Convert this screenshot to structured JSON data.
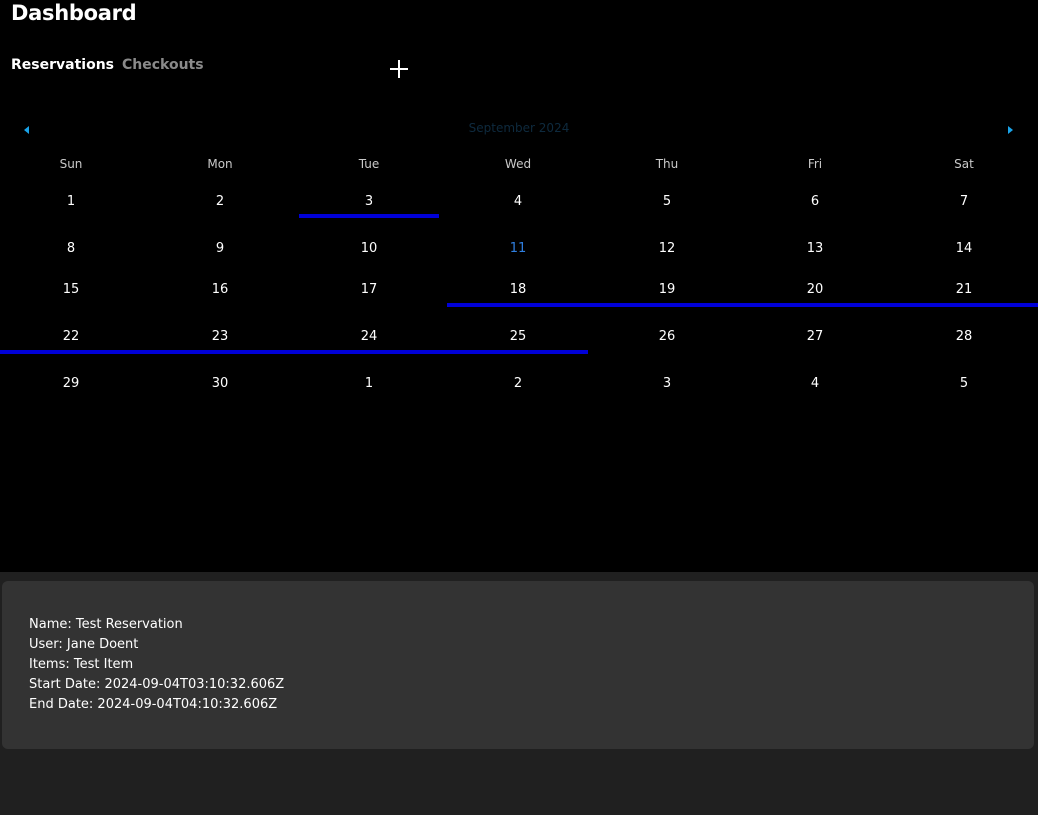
{
  "header": {
    "title": "Dashboard"
  },
  "tabs": [
    {
      "label": "Reservations",
      "active": true
    },
    {
      "label": "Checkouts",
      "active": false
    }
  ],
  "add_icon": "plus-icon",
  "calendar": {
    "month_label": "September 2024",
    "prev_icon": "caret-left-icon",
    "next_icon": "caret-right-icon",
    "accent_color": "#1aa3e8",
    "today_color": "#2f7fe0",
    "reservation_bar_color": "#0000d8",
    "weekdays": [
      "Sun",
      "Mon",
      "Tue",
      "Wed",
      "Thu",
      "Fri",
      "Sat"
    ],
    "weeks": [
      [
        "1",
        "2",
        "3",
        "4",
        "5",
        "6",
        "7"
      ],
      [
        "8",
        "9",
        "10",
        "11",
        "12",
        "13",
        "14"
      ],
      [
        "15",
        "16",
        "17",
        "18",
        "19",
        "20",
        "21"
      ],
      [
        "22",
        "23",
        "24",
        "25",
        "26",
        "27",
        "28"
      ],
      [
        "29",
        "30",
        "1",
        "2",
        "3",
        "4",
        "5"
      ]
    ],
    "today": "11"
  },
  "details": {
    "name_line": "Name: Test Reservation",
    "user_line": "User: Jane Doent",
    "items_line": "Items: Test Item",
    "start_line": "Start Date: 2024-09-04T03:10:32.606Z",
    "end_line": "End Date: 2024-09-04T04:10:32.606Z"
  }
}
